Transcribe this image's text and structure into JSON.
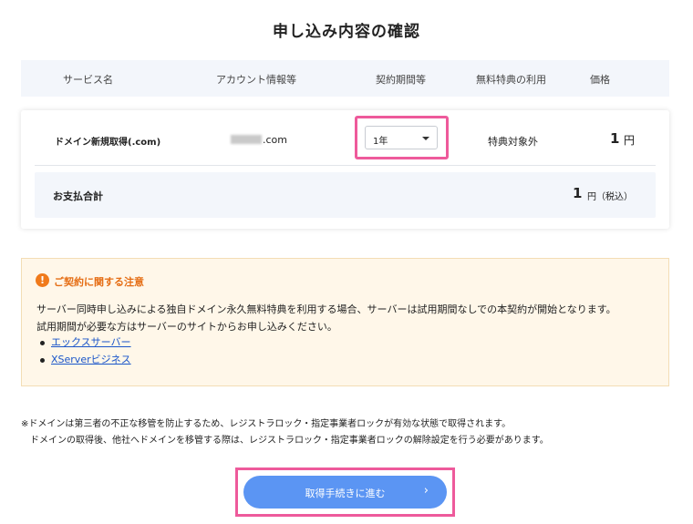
{
  "page": {
    "title": "申し込み内容の確認"
  },
  "table": {
    "headers": [
      "サービス名",
      "アカウント情報等",
      "契約期間等",
      "無料特典の利用",
      "価格"
    ],
    "row": {
      "service": "ドメイン新規取得(.com)",
      "account_suffix": ".com",
      "term_selected": "1年",
      "benefit": "特典対象外",
      "price": "1",
      "price_unit": "円"
    },
    "total": {
      "label": "お支払合計",
      "amount": "1",
      "unit": "円（税込）"
    }
  },
  "notice": {
    "icon": "exclamation-icon",
    "title": "ご契約に関する注意",
    "lines": [
      "サーバー同時申し込みによる独自ドメイン永久無料特典を利用する場合、サーバーは試用期間なしでの本契約が開始となります。",
      "試用期間が必要な方はサーバーのサイトからお申し込みください。"
    ],
    "links": [
      "エックスサーバー",
      "XServerビジネス"
    ]
  },
  "footnotes": [
    "※ドメインは第三者の不正な移管を防止するため、レジストラロック・指定事業者ロックが有効な状態で取得されます。",
    "ドメインの取得後、他社へドメインを移管する際は、レジストラロック・指定事業者ロックの解除設定を行う必要があります。"
  ],
  "actions": {
    "proceed_label": "取得手続きに進む",
    "proceed_icon": "chevron-right-icon"
  },
  "colors": {
    "highlight": "#ee5a9b",
    "button": "#5b95f3",
    "warning": "#f07a1b",
    "link": "#1a55c9"
  }
}
